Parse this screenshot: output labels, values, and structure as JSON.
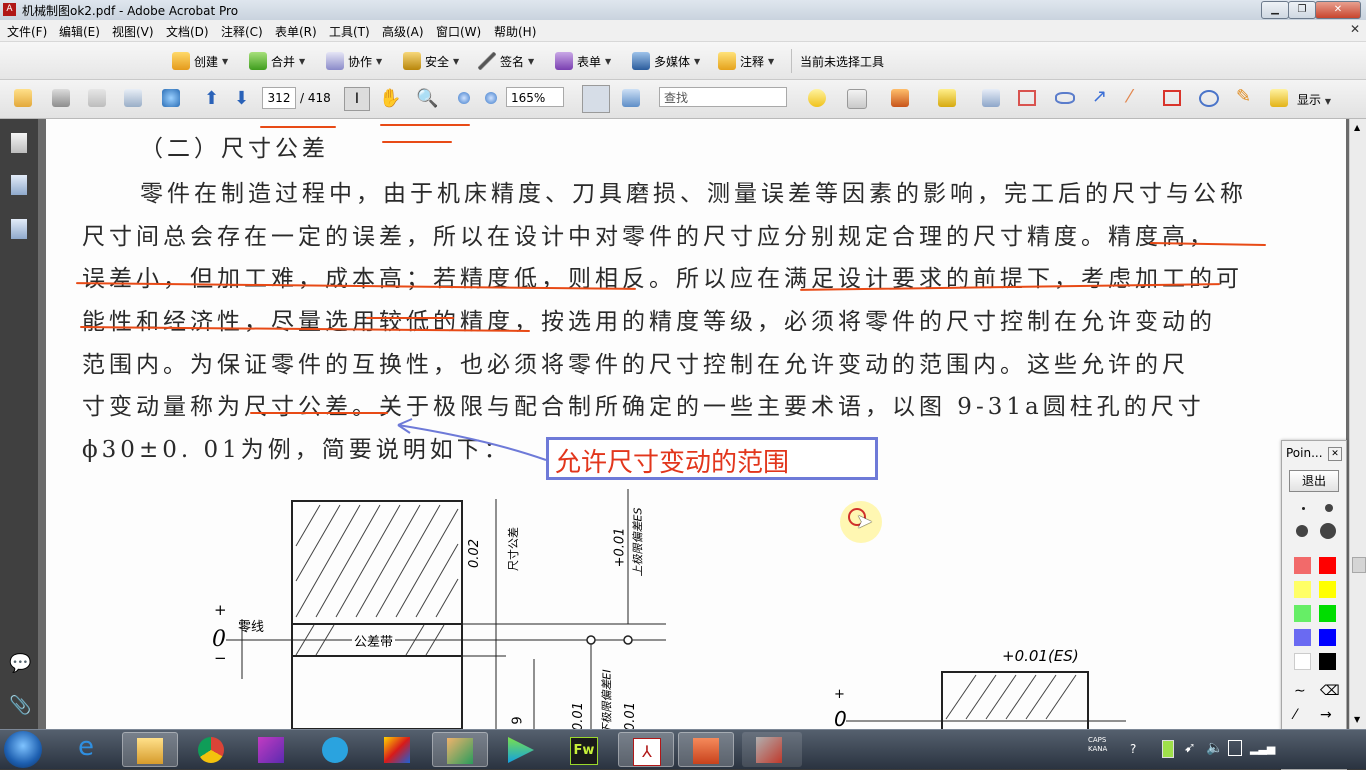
{
  "window": {
    "title": "机械制图ok2.pdf - Adobe Acrobat Pro",
    "app_icon": "acrobat-icon"
  },
  "menu": [
    "文件(F)",
    "编辑(E)",
    "视图(V)",
    "文档(D)",
    "注释(C)",
    "表单(R)",
    "工具(T)",
    "高级(A)",
    "窗口(W)",
    "帮助(H)"
  ],
  "toolbar1": {
    "items": [
      {
        "label": "创建",
        "icon": "create-icon"
      },
      {
        "label": "合并",
        "icon": "combine-icon"
      },
      {
        "label": "协作",
        "icon": "collaborate-icon"
      },
      {
        "label": "安全",
        "icon": "lock-icon"
      },
      {
        "label": "签名",
        "icon": "pen-icon"
      },
      {
        "label": "表单",
        "icon": "form-icon"
      },
      {
        "label": "多媒体",
        "icon": "multimedia-icon"
      },
      {
        "label": "注释",
        "icon": "comment-icon"
      }
    ],
    "status": "当前未选择工具"
  },
  "toolbar2": {
    "page_current": "312",
    "page_total": "/ 418",
    "zoom": "165%",
    "find_placeholder": "查找",
    "show_label": "显示"
  },
  "document": {
    "heading": "（二）尺寸公差",
    "lines": [
      "零件在制造过程中，由于机床精度、刀具磨损、测量误差等因素的影响，完工后的尺寸与公称",
      "尺寸间总会存在一定的误差，所以在设计中对零件的尺寸应分别规定合理的尺寸精度。精度高，",
      "误差小，但加工难，成本高；若精度低，则相反。所以应在满足设计要求的前提下，考虑加工的可",
      "能性和经济性，尽量选用较低的精度，按选用的精度等级，必须将零件的尺寸控制在允许变动的",
      "范围内。为保证零件的互换性，也必须将零件的尺寸控制在允许变动的范围内。这些允许的尺",
      "寸变动量称为尺寸公差。关于极限与配合制所确定的一些主要术语，以图 9-31a圆柱孔的尺寸",
      "ϕ30±0. 01为例，简要说明如下："
    ],
    "annotation": "允许尺寸变动的范围",
    "figure": {
      "zero_line_label": "零线",
      "zero_symbol": "0",
      "plus_symbol": "+",
      "minus_symbol": "−",
      "tolerance_zone_label": "公差带",
      "tolerance_value": "0.02",
      "tolerance_caption": "尺寸公差",
      "upper_dev_value": "+0.01",
      "upper_dev_caption": "上极限偏差ES",
      "lower_dev_value": "0.01",
      "lower_dev_caption": "下极限偏差EI",
      "right_label": "+0.01(ES)",
      "bottom_nums": [
        "9",
        "0.01",
        "0.01"
      ]
    }
  },
  "palette": {
    "title": "Poin...",
    "exit_label": "退出",
    "colors": [
      "#f26a6a",
      "#ff0000",
      "#ffff66",
      "#ffff00",
      "#66ee66",
      "#00dd00",
      "#6a6af2",
      "#0000ff",
      "#ffffff",
      "#000000"
    ]
  },
  "taskbar": {
    "apps": [
      "ie-icon",
      "explorer-icon",
      "chrome-icon",
      "app-icon",
      "telegram-icon",
      "app2-icon",
      "app3-icon",
      "media-player-icon",
      "fireworks-icon",
      "acrobat-icon",
      "presentation-icon",
      "pointer-app-icon"
    ],
    "fireworks_label": "Fw",
    "tray_caps": "CAPS",
    "tray_kana": "KANA"
  }
}
